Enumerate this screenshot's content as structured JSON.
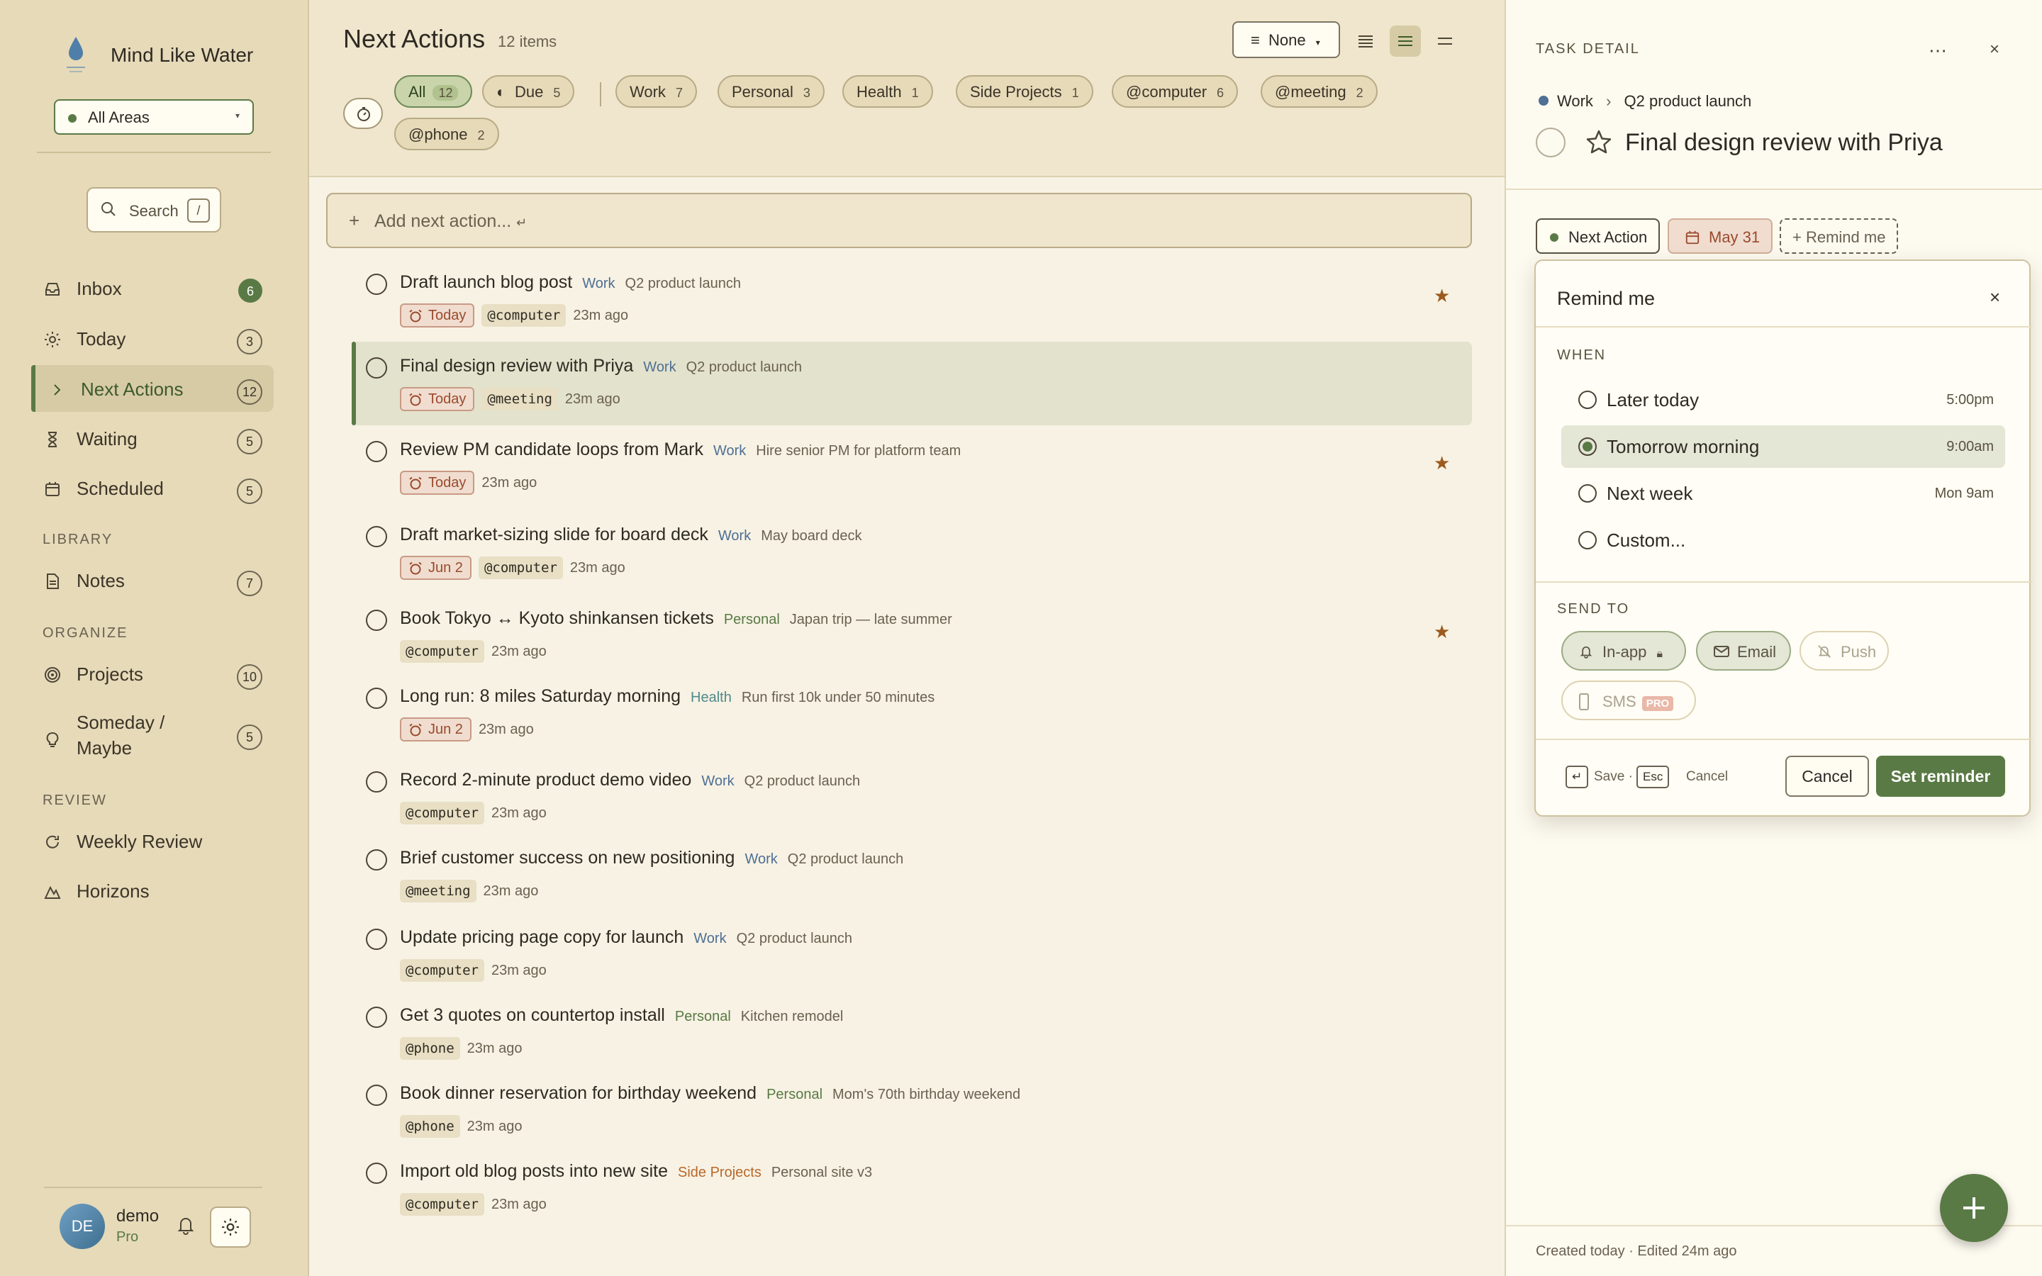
{
  "app": {
    "name": "Mind Like Water"
  },
  "sidebar": {
    "area_select": "All Areas",
    "search": {
      "label": "Search",
      "shortcut": "/"
    },
    "nav": [
      {
        "label": "Inbox",
        "count": "6",
        "icon": "inbox-icon"
      },
      {
        "label": "Today",
        "count": "3",
        "icon": "sun-icon"
      },
      {
        "label": "Next Actions",
        "count": "12",
        "icon": "chevron-right-icon"
      },
      {
        "label": "Waiting",
        "count": "5",
        "icon": "hourglass-icon"
      },
      {
        "label": "Scheduled",
        "count": "5",
        "icon": "calendar-icon"
      }
    ],
    "library_heading": "LIBRARY",
    "library": [
      {
        "label": "Notes",
        "count": "7",
        "icon": "notes-icon"
      }
    ],
    "organize_heading": "ORGANIZE",
    "organize": [
      {
        "label": "Projects",
        "count": "10",
        "icon": "target-icon"
      },
      {
        "label": "Someday /",
        "label2": "Maybe",
        "count": "5",
        "icon": "lightbulb-icon"
      }
    ],
    "review_heading": "REVIEW",
    "review": [
      {
        "label": "Weekly Review",
        "icon": "refresh-icon"
      },
      {
        "label": "Horizons",
        "icon": "mountain-icon"
      }
    ],
    "user": {
      "initials": "DE",
      "name": "demo",
      "plan": "Pro"
    }
  },
  "main": {
    "title": "Next Actions",
    "count": "12 items",
    "sort_label": "None",
    "filters": [
      {
        "label": "All",
        "count": "12"
      },
      {
        "label": "Due",
        "count": "5"
      },
      {
        "label": "Work",
        "count": "7"
      },
      {
        "label": "Personal",
        "count": "3"
      },
      {
        "label": "Health",
        "count": "1"
      },
      {
        "label": "Side Projects",
        "count": "1"
      },
      {
        "label": "@computer",
        "count": "6"
      },
      {
        "label": "@meeting",
        "count": "2"
      },
      {
        "label": "@phone",
        "count": "2"
      }
    ],
    "add_placeholder": "Add next action...",
    "add_symbol": "↵",
    "tasks": [
      {
        "title": "Draft launch blog post",
        "area": "Work",
        "project": "Q2 product launch",
        "due": "Today",
        "context": "@computer",
        "age": "23m ago",
        "starred": true
      },
      {
        "title": "Final design review with Priya",
        "area": "Work",
        "project": "Q2 product launch",
        "due": "Today",
        "context": "@meeting",
        "age": "23m ago",
        "starred": false
      },
      {
        "title": "Review PM candidate loops from Mark",
        "area": "Work",
        "project": "Hire senior PM for platform team",
        "due": "Today",
        "context": "",
        "age": "23m ago",
        "starred": true
      },
      {
        "title": "Draft market-sizing slide for board deck",
        "area": "Work",
        "project": "May board deck",
        "due": "Jun 2",
        "context": "@computer",
        "age": "23m ago",
        "starred": false
      },
      {
        "title": "Book Tokyo ↔ Kyoto shinkansen tickets",
        "area": "Personal",
        "project": "Japan trip — late summer",
        "due": "",
        "context": "@computer",
        "age": "23m ago",
        "starred": true
      },
      {
        "title": "Long run: 8 miles Saturday morning",
        "area": "Health",
        "project": "Run first 10k under 50 minutes",
        "due": "Jun 2",
        "context": "",
        "age": "23m ago",
        "starred": false
      },
      {
        "title": "Record 2-minute product demo video",
        "area": "Work",
        "project": "Q2 product launch",
        "due": "",
        "context": "@computer",
        "age": "23m ago",
        "starred": false
      },
      {
        "title": "Brief customer success on new positioning",
        "area": "Work",
        "project": "Q2 product launch",
        "due": "",
        "context": "@meeting",
        "age": "23m ago",
        "starred": false
      },
      {
        "title": "Update pricing page copy for launch",
        "area": "Work",
        "project": "Q2 product launch",
        "due": "",
        "context": "@computer",
        "age": "23m ago",
        "starred": false
      },
      {
        "title": "Get 3 quotes on countertop install",
        "area": "Personal",
        "project": "Kitchen remodel",
        "due": "",
        "context": "@phone",
        "age": "23m ago",
        "starred": false
      },
      {
        "title": "Book dinner reservation for birthday weekend",
        "area": "Personal",
        "project": "Mom's 70th birthday weekend",
        "due": "",
        "context": "@phone",
        "age": "23m ago",
        "starred": false
      },
      {
        "title": "Import old blog posts into new site",
        "area": "Side Projects",
        "project": "Personal site v3",
        "due": "",
        "context": "@computer",
        "age": "23m ago",
        "starred": false
      }
    ]
  },
  "colors": {
    "Work": "#4f6f94",
    "Personal": "#5a7a45",
    "Health": "#4f8a8a",
    "Side Projects": "#b8682a"
  },
  "detail": {
    "heading": "TASK DETAIL",
    "crumb_area": "Work",
    "crumb_sep": "›",
    "crumb_project": "Q2 product launch",
    "title": "Final design review with Priya",
    "status": "Next Action",
    "due": "May 31",
    "remind": "+ Remind me",
    "footer": "Created today · Edited 24m ago"
  },
  "reminder": {
    "title": "Remind me",
    "when_heading": "WHEN",
    "options": [
      {
        "label": "Later today",
        "time": "5:00pm",
        "selected": false
      },
      {
        "label": "Tomorrow morning",
        "time": "9:00am",
        "selected": true
      },
      {
        "label": "Next week",
        "time": "Mon 9am",
        "selected": false
      },
      {
        "label": "Custom...",
        "time": "",
        "selected": false
      }
    ],
    "send_heading": "SEND TO",
    "channels": [
      {
        "label": "In-app",
        "state": "on"
      },
      {
        "label": "Email",
        "state": "on"
      },
      {
        "label": "Push",
        "state": "off"
      },
      {
        "label": "SMS",
        "state": "off",
        "badge": "PRO"
      }
    ],
    "save_key": "↵",
    "save_hint": "Save ·",
    "esc_key": "Esc",
    "cancel_hint": "Cancel",
    "cancel_label": "Cancel",
    "set_label": "Set reminder"
  }
}
